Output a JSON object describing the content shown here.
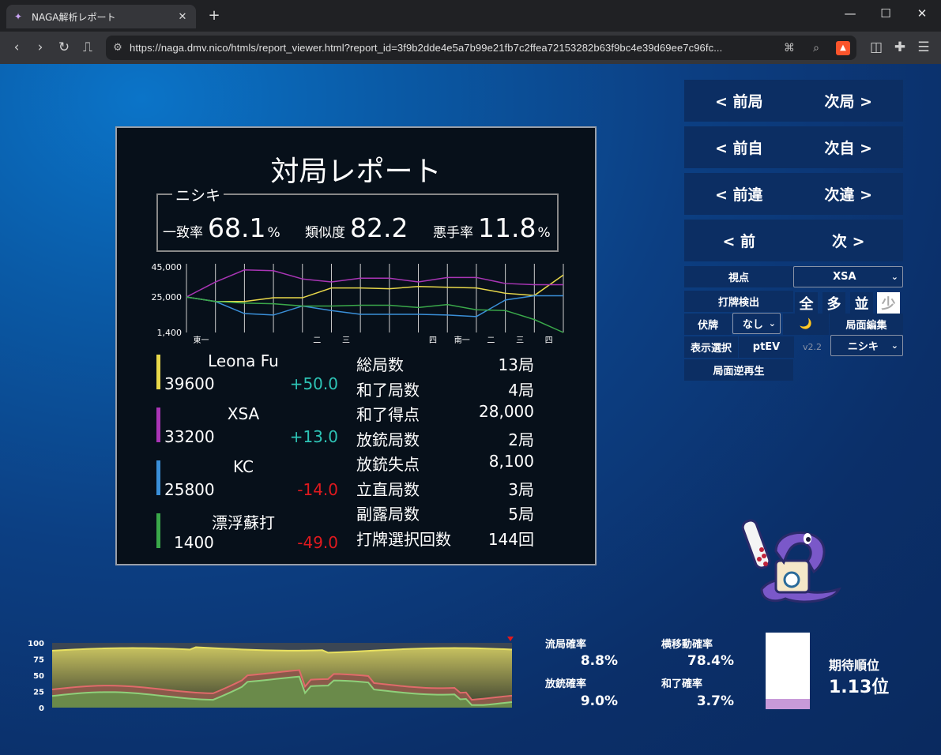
{
  "browser": {
    "tab_title": "NAGA解析レポート",
    "url": "https://naga.dmv.nico/htmls/report_viewer.html?report_id=3f9b2dde4e5a7b99e21fb7c2ffea72153282b63f9bc4e39d69ee7c96fc..."
  },
  "report": {
    "title": "対局レポート",
    "player": "ニシキ",
    "stats": [
      {
        "label": "一致率",
        "value": "68.1",
        "unit": "%"
      },
      {
        "label": "類似度",
        "value": "82.2",
        "unit": ""
      },
      {
        "label": "悪手率",
        "value": "11.8",
        "unit": "%"
      }
    ],
    "chart_data": {
      "type": "line",
      "y_ticks": [
        "45,000",
        "25,000",
        "1,400"
      ],
      "ylim": [
        1400,
        45000
      ],
      "x_labels": [
        "東一",
        "",
        "",
        "",
        "二",
        "三",
        "",
        "",
        "四",
        "南一",
        "二",
        "三",
        "四",
        "",
        ""
      ],
      "series": [
        {
          "name": "Leona Fu",
          "color": "#e8d84a",
          "values": [
            25000,
            22000,
            22000,
            24500,
            24500,
            31000,
            31000,
            30500,
            32000,
            31500,
            31000,
            27500,
            26000,
            39600
          ]
        },
        {
          "name": "XSA",
          "color": "#a935b5",
          "values": [
            25000,
            35000,
            43000,
            42500,
            37000,
            35000,
            37500,
            37500,
            35000,
            38000,
            38000,
            34000,
            33200,
            33200
          ]
        },
        {
          "name": "KC",
          "color": "#3a8fd8",
          "values": [
            25000,
            22000,
            14000,
            13000,
            19000,
            16000,
            13500,
            13500,
            13500,
            13000,
            12000,
            23000,
            25800,
            25800
          ]
        },
        {
          "name": "漂浮蘇打",
          "color": "#3aa84a",
          "values": [
            25000,
            22000,
            21000,
            20500,
            19000,
            19000,
            19500,
            19500,
            18000,
            20000,
            16500,
            16000,
            10000,
            1400
          ]
        }
      ]
    },
    "players": [
      {
        "name": "Leona Fu",
        "score": "39600",
        "diff": "+50.0",
        "color": "#e8d84a",
        "diff_color": "#2ec4b6"
      },
      {
        "name": "XSA",
        "score": "33200",
        "diff": "+13.0",
        "color": "#a935b5",
        "diff_color": "#2ec4b6"
      },
      {
        "name": "KC",
        "score": "25800",
        "diff": "-14.0",
        "color": "#3a8fd8",
        "diff_color": "#e0191e"
      },
      {
        "name": "漂浮蘇打",
        "score": "1400",
        "diff": "-49.0",
        "color": "#3aa84a",
        "diff_color": "#e0191e"
      }
    ],
    "summary": [
      {
        "k": "総局数",
        "v": "13局"
      },
      {
        "k": "和了局数",
        "v": "4局"
      },
      {
        "k": "和了得点",
        "v": "28,000"
      },
      {
        "k": "放銃局数",
        "v": "2局"
      },
      {
        "k": "放銃失点",
        "v": "8,100"
      },
      {
        "k": "立直局数",
        "v": "3局"
      },
      {
        "k": "副露局数",
        "v": "5局"
      },
      {
        "k": "打牌選択回数",
        "v": "144回"
      }
    ]
  },
  "nav": {
    "rows": [
      {
        "prev": "< 前局",
        "next": "次局 >"
      },
      {
        "prev": "< 前自",
        "next": "次自 >"
      },
      {
        "prev": "< 前違",
        "next": "次違 >"
      },
      {
        "prev": "< 前",
        "next": "次 >"
      }
    ]
  },
  "controls": {
    "viewpoint_label": "視点",
    "viewpoint_value": "XSA",
    "discard_detect_label": "打牌検出",
    "discard_levels": [
      "全",
      "多",
      "並",
      "少"
    ],
    "fukuhai_label": "伏牌",
    "fukuhai_value": "なし",
    "moon": "🌙",
    "edit_label": "局面編集",
    "display_label": "表示選択",
    "ptev": "ptEV",
    "version": "v2.2",
    "model_value": "ニシキ",
    "reverse_label": "局面逆再生"
  },
  "bottom": {
    "chart_data": {
      "type": "area",
      "y_ticks": [
        "100",
        "75",
        "50",
        "25",
        "0"
      ],
      "ylim": [
        0,
        100
      ]
    },
    "probs": [
      {
        "label": "流局確率",
        "value": "8.8%"
      },
      {
        "label": "横移動確率",
        "value": "78.4%"
      },
      {
        "label": "放銃確率",
        "value": "9.0%"
      },
      {
        "label": "和了確率",
        "value": "3.7%"
      }
    ],
    "expected_label": "期待順位",
    "expected_value": "1.13位",
    "expected_fill": 0.13
  }
}
